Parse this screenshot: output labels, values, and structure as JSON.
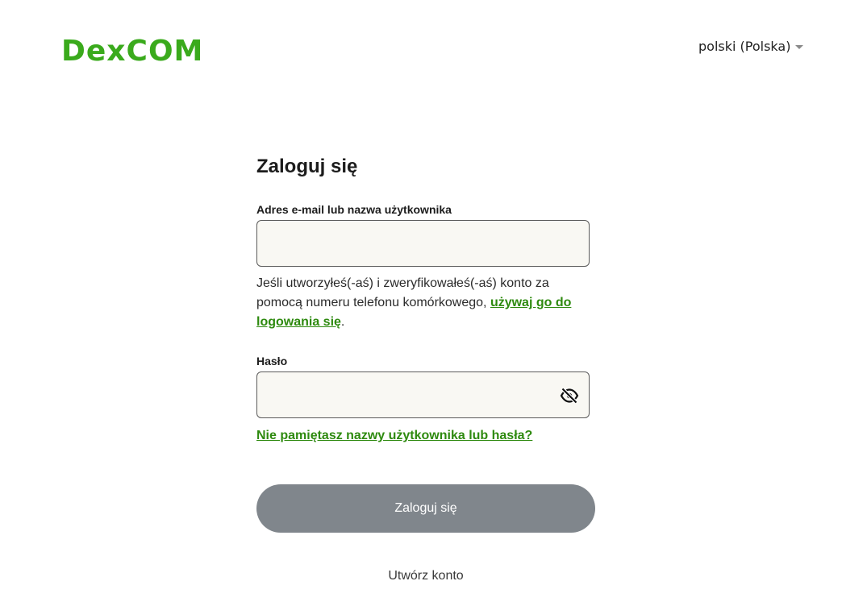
{
  "header": {
    "logo_text": "DexCOM",
    "language": "polski (Polska)"
  },
  "form": {
    "title": "Zaloguj się",
    "email_label": "Adres e-mail lub nazwa użytkownika",
    "email_value": "",
    "hint_text": "Jeśli utworzyłeś(-aś) i zweryfikowałeś(-aś) konto za pomocą numeru telefonu komórkowego, ",
    "hint_link": "używaj go do logowania się",
    "hint_end": ".",
    "password_label": "Hasło",
    "password_value": "",
    "forgot_link": "Nie pamiętasz nazwy użytkownika lub hasła?",
    "submit_label": "Zaloguj się",
    "create_account": "Utwórz konto"
  },
  "colors": {
    "brand_green": "#3aaa1c",
    "link_green": "#2e8a0f",
    "button_disabled": "#80868c",
    "input_bg": "#f9f8f3"
  },
  "icons": {
    "password_toggle": "eye-slash-icon"
  }
}
